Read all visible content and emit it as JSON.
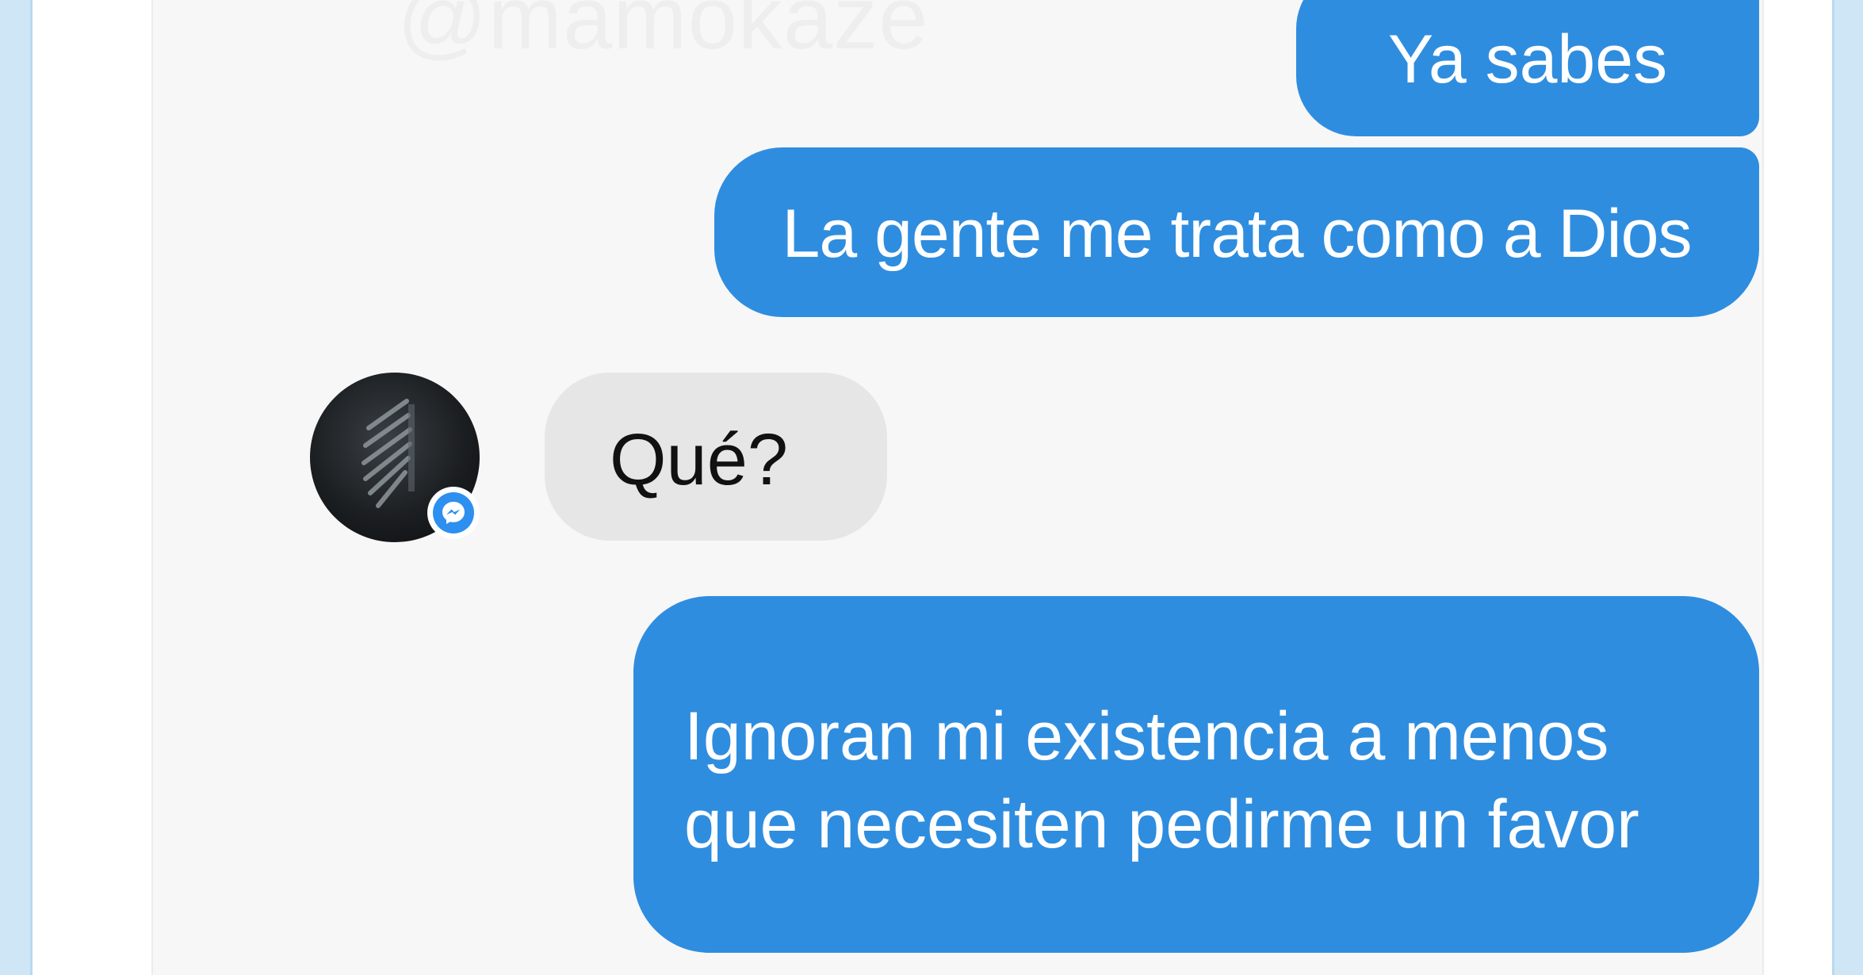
{
  "watermark": "@mamokaze",
  "messages": [
    {
      "direction": "outgoing",
      "text": "Ya sabes"
    },
    {
      "direction": "outgoing",
      "text": "La gente me trata como a Dios"
    },
    {
      "direction": "incoming",
      "text": "Qué?"
    },
    {
      "direction": "outgoing",
      "lines": [
        "Ignoran mi existencia a menos",
        "que necesiten pedirme un favor"
      ]
    }
  ],
  "contact": {
    "avatar_icon": "wings-of-freedom-emblem-icon",
    "badge_icon": "messenger-icon"
  },
  "colors": {
    "outgoing_bubble": "#2f8ddf",
    "incoming_bubble": "#e6e6e6",
    "chat_background": "#f7f7f7",
    "page_background": "#cfe6f6"
  }
}
